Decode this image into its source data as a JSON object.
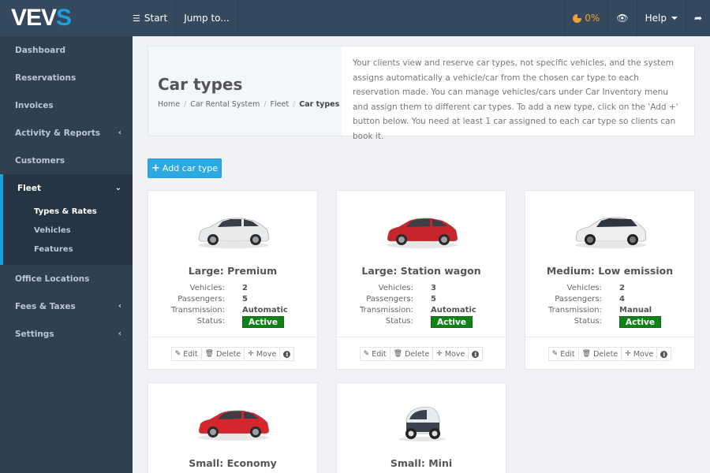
{
  "app": {
    "logo_main": "VEV",
    "logo_accent": "S"
  },
  "topbar": {
    "start_label": "Start",
    "jump_label": "Jump to...",
    "progress_value": "0%",
    "help_label": "Help"
  },
  "sidebar": {
    "items": [
      {
        "label": "Dashboard",
        "has_submenu": false
      },
      {
        "label": "Reservations",
        "has_submenu": false
      },
      {
        "label": "Invoices",
        "has_submenu": false
      },
      {
        "label": "Activity & Reports",
        "has_submenu": true
      },
      {
        "label": "Customers",
        "has_submenu": false
      }
    ],
    "fleet": {
      "label": "Fleet",
      "expanded": true,
      "sub_items": [
        {
          "label": "Types & Rates",
          "active": true
        },
        {
          "label": "Vehicles",
          "active": false
        },
        {
          "label": "Features",
          "active": false
        }
      ]
    },
    "items_after": [
      {
        "label": "Office Locations",
        "has_submenu": false
      },
      {
        "label": "Fees & Taxes",
        "has_submenu": true
      },
      {
        "label": "Settings",
        "has_submenu": true
      }
    ]
  },
  "header": {
    "title": "Car types",
    "breadcrumb": [
      "Home",
      "Car Rental System",
      "Fleet",
      "Car types"
    ],
    "description": "Your clients view and reserve car types, not specific vehicles, and the system assigns automatically a vehicle/car from the chosen car type to each reservation made. You can manage vehicles/cars under Car Inventory menu and assign them to different car types. To add a new type, click on the 'Add +' button below. You need at least 1 car assigned to each car type so clients can book it."
  },
  "add_button_label": "Add car type",
  "labels": {
    "vehicles": "Vehicles:",
    "passengers": "Passengers:",
    "transmission": "Transmission:",
    "status": "Status:",
    "edit": "Edit",
    "delete": "Delete",
    "move": "Move"
  },
  "car_types": [
    {
      "name": "Large: Premium",
      "vehicles": "2",
      "passengers": "5",
      "transmission": "Automatic",
      "status": "Active",
      "image": "white-sedan",
      "color": "#e8eaec"
    },
    {
      "name": "Large: Station wagon",
      "vehicles": "3",
      "passengers": "5",
      "transmission": "Automatic",
      "status": "Active",
      "image": "red-wagon",
      "color": "#c8242b"
    },
    {
      "name": "Medium: Low emission",
      "vehicles": "2",
      "passengers": "4",
      "transmission": "Manual",
      "status": "Active",
      "image": "white-suv",
      "color": "#eeeeee"
    },
    {
      "name": "Small: Economy",
      "image": "red-hatchback",
      "color": "#d4262c"
    },
    {
      "name": "Small: Mini",
      "image": "mini-ev",
      "color": "#3a4250"
    }
  ],
  "colors": {
    "topbar": "#34495e",
    "sidebar": "#2f4051",
    "accent": "#1e9fdc",
    "add_button": "#2ba9e1",
    "status_active": "#118218",
    "progress": "#f0a030"
  }
}
